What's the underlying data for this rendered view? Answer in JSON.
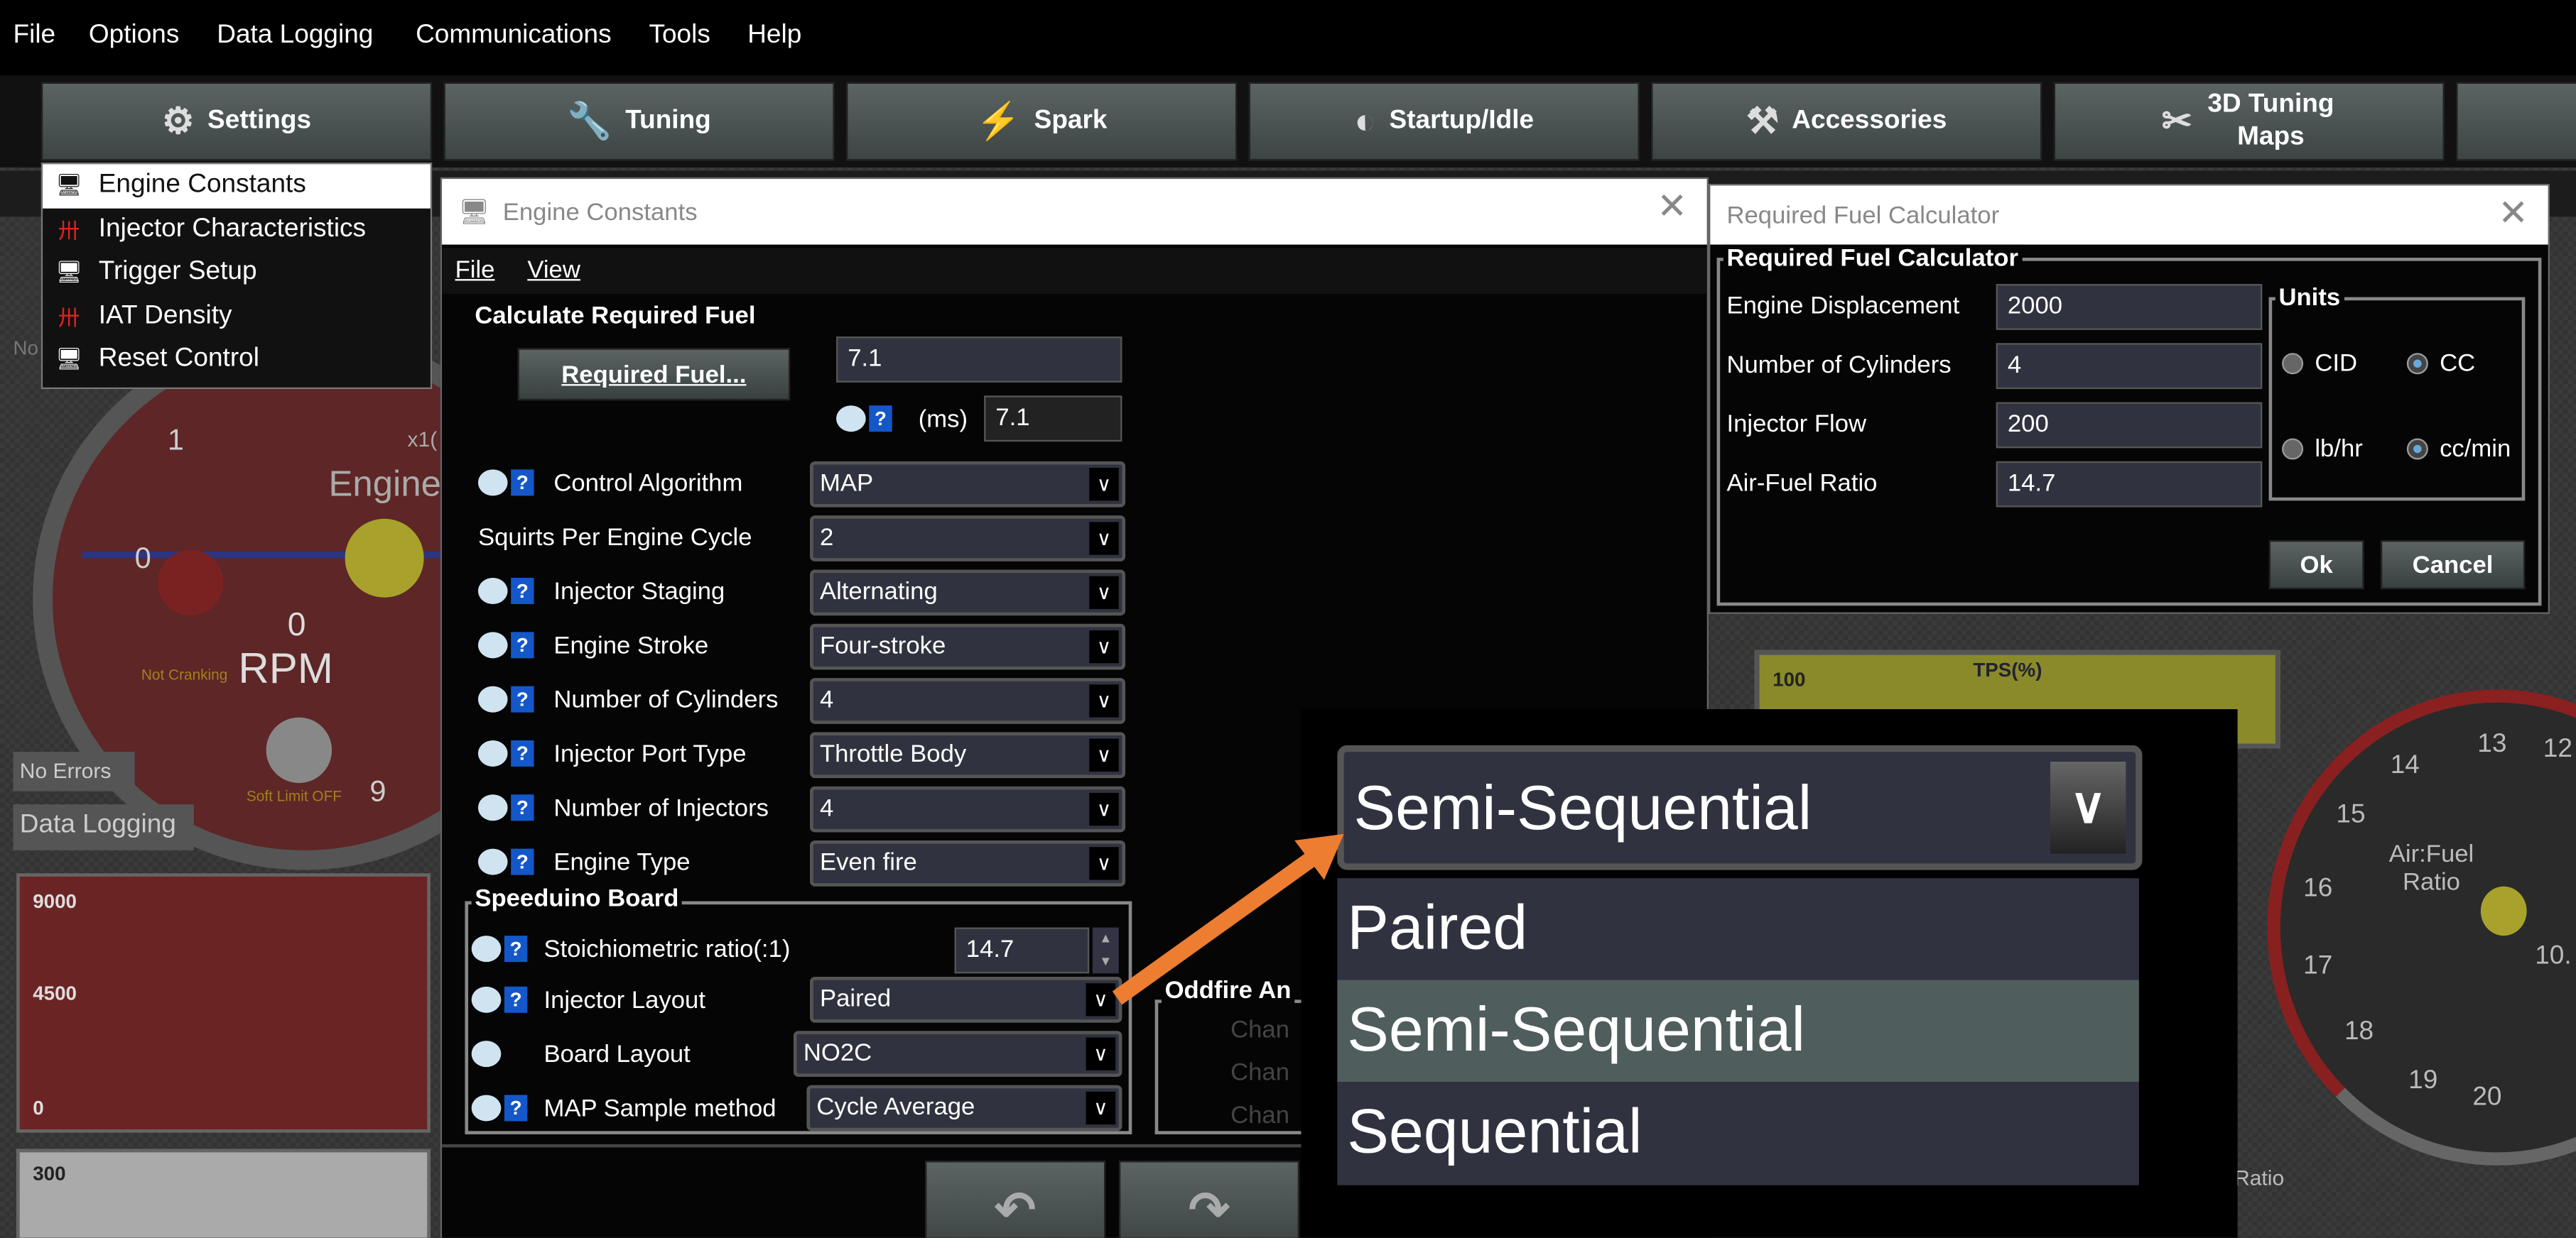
{
  "menubar": [
    "File",
    "Options",
    "Data Logging",
    "Communications",
    "Tools",
    "Help"
  ],
  "toolbar": [
    {
      "label": "Settings",
      "icon": "gear-icon"
    },
    {
      "label": "Tuning",
      "icon": "wrench-icon"
    },
    {
      "label": "Spark",
      "icon": "spark-plug-icon"
    },
    {
      "label": "Startup/Idle",
      "icon": "startup-icon"
    },
    {
      "label": "Accessories",
      "icon": "tools-icon"
    },
    {
      "label": "3D Tuning Maps",
      "icon": "tuning-maps-icon"
    }
  ],
  "settings_menu": [
    "Engine Constants",
    "Injector Characteristics",
    "Trigger Setup",
    "IAT Density",
    "Reset Control"
  ],
  "dashboard": {
    "rpm_gauge": {
      "tick_1": "1",
      "tick_0": "0",
      "tick_9": "9",
      "mult": "x1(",
      "title": "Engine",
      "value": "0",
      "unit": "RPM",
      "cranking": "Not Cranking",
      "soft_limit": "Soft Limit OFF"
    },
    "no_errors": "No Errors",
    "data_logging": "Data Logging",
    "chart_labels": [
      "9000",
      "4500",
      "0"
    ],
    "chart2_label": "300",
    "tps_label": "TPS(%)",
    "tps_value": "100",
    "afr_gauge": {
      "title": "Air:Fuel Ratio",
      "ticks": [
        "12",
        "13",
        "14",
        "15",
        "16",
        "17",
        "18",
        "19",
        "20",
        "10."
      ]
    },
    "ratio_label": "Ratio",
    "side_label": "No"
  },
  "engine_constants": {
    "title": "Engine Constants",
    "menu": [
      "File",
      "View"
    ],
    "section": "Calculate Required Fuel",
    "req_fuel_button": "Required Fuel...",
    "req_fuel_value": "7.1",
    "ms_label": "(ms)",
    "ms_value": "7.1",
    "fields": [
      {
        "label": "Control Algorithm",
        "value": "MAP",
        "icons": true
      },
      {
        "label": "Squirts Per Engine Cycle",
        "value": "2",
        "icons": false
      },
      {
        "label": "Injector Staging",
        "value": "Alternating",
        "icons": true
      },
      {
        "label": "Engine Stroke",
        "value": "Four-stroke",
        "icons": true
      },
      {
        "label": "Number of Cylinders",
        "value": "4",
        "icons": true
      },
      {
        "label": "Injector Port Type",
        "value": "Throttle Body",
        "icons": true
      },
      {
        "label": "Number of Injectors",
        "value": "4",
        "icons": true
      },
      {
        "label": "Engine Type",
        "value": "Even fire",
        "icons": true
      }
    ],
    "board_section": "Speeduino Board",
    "stoich_label": "Stoichiometric ratio(:1)",
    "stoich_value": "14.7",
    "injector_layout_label": "Injector Layout",
    "injector_layout_value": "Paired",
    "board_layout_label": "Board Layout",
    "board_layout_value": "NO2C",
    "map_sample_label": "MAP Sample method",
    "map_sample_value": "Cycle Average",
    "oddfire_section": "Oddfire An",
    "oddfire_items": [
      "Chan",
      "Chan",
      "Chan"
    ]
  },
  "req_fuel_calc": {
    "title": "Required Fuel Calculator",
    "section": "Required Fuel Calculator",
    "fields": [
      {
        "label": "Engine Displacement",
        "value": "2000"
      },
      {
        "label": "Number of Cylinders",
        "value": "4"
      },
      {
        "label": "Injector Flow",
        "value": "200"
      },
      {
        "label": "Air-Fuel Ratio",
        "value": "14.7"
      }
    ],
    "units_title": "Units",
    "units": [
      {
        "label": "CID",
        "selected": false
      },
      {
        "label": "CC",
        "selected": true
      },
      {
        "label": "lb/hr",
        "selected": false
      },
      {
        "label": "cc/min",
        "selected": true
      }
    ],
    "ok": "Ok",
    "cancel": "Cancel"
  },
  "zoom_inset": {
    "selected": "Semi-Sequential",
    "options": [
      "Paired",
      "Semi-Sequential",
      "Sequential"
    ],
    "highlighted": "Semi-Sequential"
  },
  "colors": {
    "arrow": "#ed7d31",
    "rpm_gauge": "#6b2424",
    "tps_bar": "#8a8a2a"
  }
}
